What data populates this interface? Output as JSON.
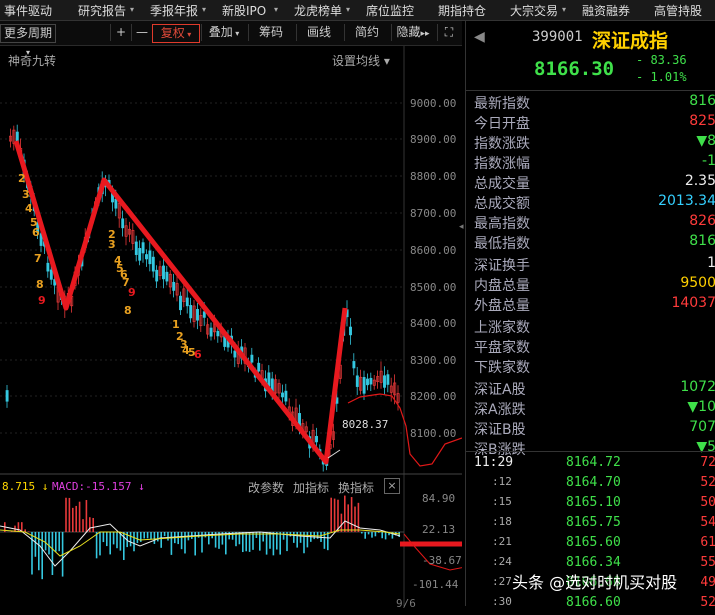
{
  "menu": {
    "items": [
      "事件驱动",
      "研究报告",
      "季报年报",
      "新股IPO",
      "龙虎榜单",
      "席位监控",
      "期指持仓",
      "大宗交易",
      "融资融券",
      "高管持股"
    ]
  },
  "toolbar": {
    "period": "更多周期",
    "plus": "+",
    "minus": "—",
    "fuquan": "复权",
    "overlay": "叠加",
    "chips": "筹码",
    "draw": "画线",
    "simple": "简约",
    "hide": "隐藏"
  },
  "chart": {
    "indicator_name": "神奇九转",
    "settings_label": "设置均线",
    "y_ticks": [
      "9000.00",
      "8900.00",
      "8800.00",
      "8700.00",
      "8600.00",
      "8500.00",
      "8400.00",
      "8300.00",
      "8200.00",
      "8100.00"
    ],
    "low_label": "8028.37",
    "td_seq_1": [
      "2",
      "3",
      "4",
      "5",
      "6",
      "7",
      "8",
      "9"
    ],
    "td_seq_2": [
      "2",
      "3",
      "4",
      "5",
      "6",
      "7",
      "8",
      "9"
    ],
    "td_seq_3": [
      "1",
      "2",
      "3",
      "4",
      "5",
      "6"
    ]
  },
  "macd": {
    "value_left": "8.715",
    "label": "MACD:-15.157",
    "change_params": "改参数",
    "add_indicator": "加指标",
    "switch_indicator": "换指标",
    "close": "×",
    "y_ticks": [
      "84.90",
      "22.13",
      "-38.67",
      "-101.44"
    ],
    "date_label": "9/6"
  },
  "quote": {
    "code": "399001",
    "name": "深证成指",
    "price": "8166.30",
    "change": "- 83.36",
    "change_pct": "- 1.01%",
    "rows": [
      {
        "label": "最新指数",
        "value": "816",
        "color": "green"
      },
      {
        "label": "今日开盘",
        "value": "825",
        "color": "red"
      },
      {
        "label": "指数涨跌",
        "value": "▼8",
        "color": "green"
      },
      {
        "label": "指数涨幅",
        "value": "-1",
        "color": "green"
      },
      {
        "label": "总成交量",
        "value": "2.35",
        "color": "white"
      },
      {
        "label": "总成交额",
        "value": "2013.34",
        "color": "cyan"
      },
      {
        "label": "最高指数",
        "value": "826",
        "color": "red"
      },
      {
        "label": "最低指数",
        "value": "816",
        "color": "green"
      },
      {
        "label": "深证换手",
        "value": "1",
        "color": "white"
      },
      {
        "label": "内盘总量",
        "value": "9500",
        "color": "yellow"
      },
      {
        "label": "外盘总量",
        "value": "14037",
        "color": "red"
      },
      {
        "label": "上涨家数",
        "value": "",
        "color": "red"
      },
      {
        "label": "平盘家数",
        "value": "",
        "color": "white"
      },
      {
        "label": "下跌家数",
        "value": "",
        "color": "green"
      },
      {
        "label": "深证A股",
        "value": "1072",
        "color": "green"
      },
      {
        "label": "深A涨跌",
        "value": "▼10",
        "color": "green"
      },
      {
        "label": "深证B股",
        "value": "707",
        "color": "green"
      },
      {
        "label": "深B涨跌",
        "value": "▼5",
        "color": "green"
      }
    ],
    "ticks_header_time": "11:29",
    "ticks": [
      {
        "time": "11:29",
        "price": "8164.72",
        "vol": "72"
      },
      {
        "time": ":12",
        "price": "8164.70",
        "vol": "52"
      },
      {
        "time": ":15",
        "price": "8165.10",
        "vol": "50"
      },
      {
        "time": ":18",
        "price": "8165.75",
        "vol": "54"
      },
      {
        "time": ":21",
        "price": "8165.60",
        "vol": "61"
      },
      {
        "time": ":24",
        "price": "8166.34",
        "vol": "55"
      },
      {
        "time": ":27",
        "price": "8166.60",
        "vol": "49"
      },
      {
        "time": ":30",
        "price": "8166.60",
        "vol": "52"
      }
    ]
  },
  "watermark": "头条 @选对时机买对股"
}
